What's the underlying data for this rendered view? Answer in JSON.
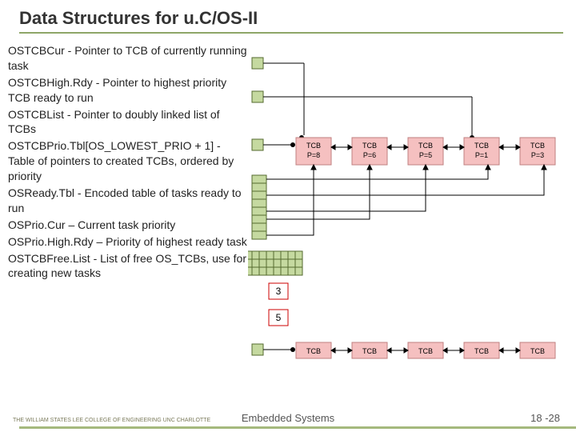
{
  "title": "Data Structures for u.C/OS-II",
  "definitions": [
    {
      "term": "OSTCBCur",
      "desc": " - Pointer to TCB of currently running task"
    },
    {
      "term": "OSTCBHigh.Rdy",
      "desc": " - Pointer to highest priority TCB ready to run"
    },
    {
      "term": "OSTCBList",
      "desc": " - Pointer to doubly linked list of TCBs"
    },
    {
      "term": "OSTCBPrio.Tbl[OS_LOWEST_PRIO + 1]",
      "desc": " - Table of pointers to created TCBs, ordered by priority"
    },
    {
      "term": "OSReady.Tbl",
      "desc": " - Encoded table of tasks ready to run"
    },
    {
      "term": "OSPrio.Cur",
      "desc": " – Current task priority"
    },
    {
      "term": "OSPrio.High.Rdy",
      "desc": " – Priority of highest ready task"
    },
    {
      "term": "OSTCBFree.List",
      "desc": " - List of free OS_TCBs, use for creating new tasks"
    }
  ],
  "tcb_row1": [
    {
      "t": "TCB",
      "p": "P=8"
    },
    {
      "t": "TCB",
      "p": "P=6"
    },
    {
      "t": "TCB",
      "p": "P=5"
    },
    {
      "t": "TCB",
      "p": "P=1"
    },
    {
      "t": "TCB",
      "p": "P=3"
    }
  ],
  "tcb_row2": [
    "TCB",
    "TCB",
    "TCB",
    "TCB",
    "TCB"
  ],
  "values": {
    "prioCur": "3",
    "prioHighRdy": "5"
  },
  "footer": {
    "center": "Embedded Systems",
    "page": "18 -28",
    "org": "THE WILLIAM STATES LEE COLLEGE OF ENGINEERING\nUNC CHARLOTTE"
  }
}
